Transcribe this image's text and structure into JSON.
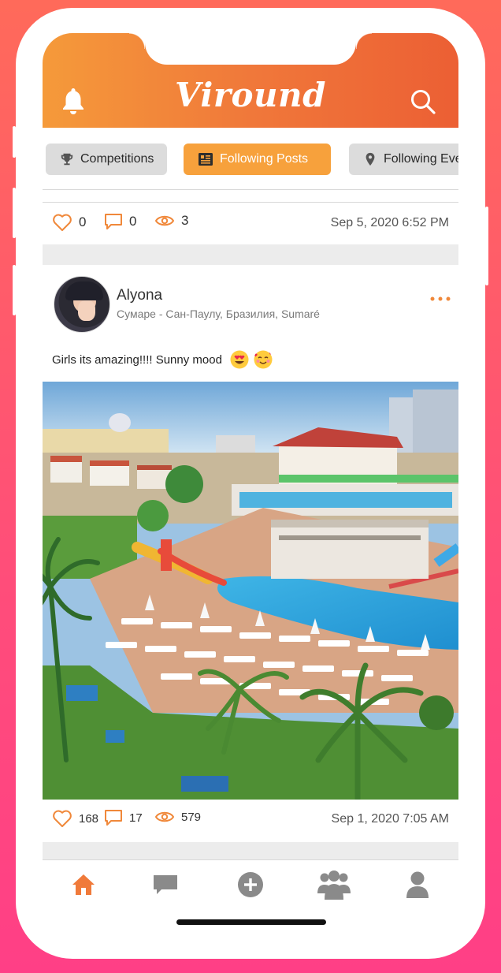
{
  "app": {
    "logo": "Viround"
  },
  "header": {
    "bell_icon": "bell-icon",
    "search_icon": "search-icon"
  },
  "tabs": [
    {
      "label": "Competitions",
      "icon": "trophy-icon",
      "active": false
    },
    {
      "label": "Following Posts",
      "icon": "newspaper-icon",
      "active": true
    },
    {
      "label": "Following Eve",
      "icon": "location-pin-icon",
      "active": false
    }
  ],
  "prev_post": {
    "likes": "0",
    "comments": "0",
    "views": "3",
    "date": "Sep 5, 2020 6:52 PM"
  },
  "post": {
    "user": "Alyona",
    "location": "Сумаре - Сан-Паулу, Бразилия, Sumaré",
    "caption": "Girls its amazing!!!! Sunny mood",
    "emojis": [
      "heart-eyes-emoji",
      "smiling-face-with-hearts-emoji"
    ],
    "likes": "168",
    "comments": "17",
    "views": "579",
    "date": "Sep 1, 2020 7:05 AM"
  },
  "tabbar": [
    {
      "name": "home",
      "icon": "home-icon",
      "active": true
    },
    {
      "name": "messages",
      "icon": "chat-icon",
      "active": false
    },
    {
      "name": "create",
      "icon": "add-circle-icon",
      "active": false
    },
    {
      "name": "groups",
      "icon": "group-icon",
      "active": false
    },
    {
      "name": "profile",
      "icon": "user-icon",
      "active": false
    }
  ],
  "colors": {
    "accent": "#f7a13c",
    "icon_orange": "#f0883a",
    "tab_inactive": "#8a8a8a"
  }
}
